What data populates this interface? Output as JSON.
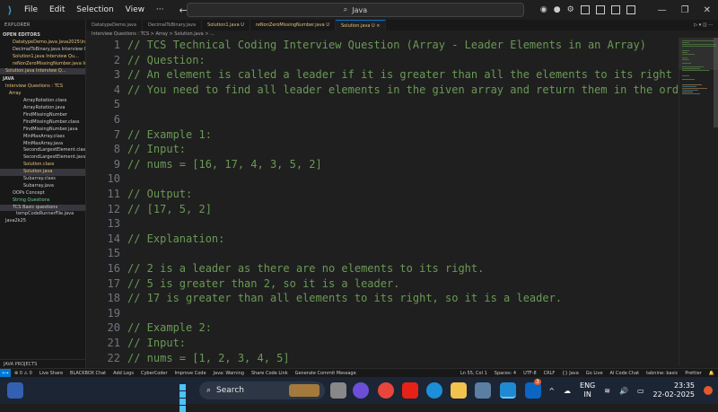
{
  "titlebar": {
    "menu": [
      "File",
      "Edit",
      "Selection",
      "View",
      "···"
    ],
    "search": "Java"
  },
  "sidebar": {
    "header": "EXPLORER",
    "open_editors_label": "OPEN EDITORS",
    "open_editors": [
      "DatatypeDemo.java  Java2025\\Int...",
      "DecimalToBinary.java  Interview Q...",
      "Solution1.java  Interview Qu...",
      "reNonZeroMissingNumber.java  Int...",
      "Solution.java  Interview Q..."
    ],
    "root_label": "JAVA",
    "tree": [
      "Interview Questions : TCS",
      "Array",
      "ArrayRotation.class",
      "ArrayRotation.java",
      "FindMissingNumber",
      "FindMissingNumber.class",
      "FindMissingNumber.java",
      "MinMaxArray.class",
      "MinMaxArray.java",
      "SecondLargestElement.class",
      "SecondLargestElement.java",
      "Solution.class",
      "Solution.java",
      "Subarray.class",
      "Subarray.java",
      "OOPs Concept",
      "String Questions",
      "TCS Basic questions",
      "tempCodeRunnerFile.java",
      "Java2k25"
    ],
    "bottom_label": "JAVA PROJECTS"
  },
  "tabs": [
    {
      "label": "DatatypeDemo.java",
      "active": false
    },
    {
      "label": "DecimalToBinary.java",
      "active": false
    },
    {
      "label": "Solution1.java  U",
      "active": false
    },
    {
      "label": "reNonZeroMissingNumber.java  U",
      "active": false
    },
    {
      "label": "Solution.java  U  ×",
      "active": true
    }
  ],
  "breadcrumb": "Interview Questions : TCS > Array > Solution.java > ...",
  "editor": {
    "lines": [
      {
        "n": "1",
        "t": "// TCS Technical Coding Interview Question (Array - Leader Elements in an Array)"
      },
      {
        "n": "2",
        "t": "// Question:"
      },
      {
        "n": "3",
        "t": "// An element is called a leader if it is greater than all the elements to its right in the"
      },
      {
        "n": "4",
        "t": "// You need to find all leader elements in the given array and return them in the order the"
      },
      {
        "n": "5",
        "t": ""
      },
      {
        "n": "6",
        "t": ""
      },
      {
        "n": "7",
        "t": "// Example 1:"
      },
      {
        "n": "8",
        "t": "// Input:"
      },
      {
        "n": "9",
        "t": "// nums = [16, 17, 4, 3, 5, 2]"
      },
      {
        "n": "10",
        "t": ""
      },
      {
        "n": "11",
        "t": "// Output:"
      },
      {
        "n": "12",
        "t": "// [17, 5, 2]"
      },
      {
        "n": "13",
        "t": ""
      },
      {
        "n": "14",
        "t": "// Explanation:"
      },
      {
        "n": "15",
        "t": ""
      },
      {
        "n": "16",
        "t": "// 2 is a leader as there are no elements to its right."
      },
      {
        "n": "17",
        "t": "// 5 is greater than 2, so it is a leader."
      },
      {
        "n": "18",
        "t": "// 17 is greater than all elements to its right, so it is a leader."
      },
      {
        "n": "19",
        "t": ""
      },
      {
        "n": "20",
        "t": "// Example 2:"
      },
      {
        "n": "21",
        "t": "// Input:"
      },
      {
        "n": "22",
        "t": "// nums = [1, 2, 3, 4, 5]"
      }
    ]
  },
  "statusbar": {
    "left": [
      "⊗ 0  ⚠ 0",
      "Live Share",
      "BLACKBOX Chat",
      "Add Logs",
      "CyberCoder",
      "Improve Code",
      "Java: Warning",
      "Share Code Link",
      "Generate Commit Message"
    ],
    "right": [
      "Ln 55, Col 1",
      "Spaces: 4",
      "UTF-8",
      "CRLF",
      "{} Java",
      "Go Live",
      "AI Code Chat",
      "tabnine: basic",
      "Prettier"
    ]
  },
  "taskbar": {
    "search_label": "Search",
    "lang_top": "ENG",
    "lang_bottom": "IN",
    "time": "23:35",
    "date": "22-02-2025",
    "badge": "3"
  },
  "colors": {
    "accent": "#0078d4",
    "comment": "#6a9955"
  }
}
